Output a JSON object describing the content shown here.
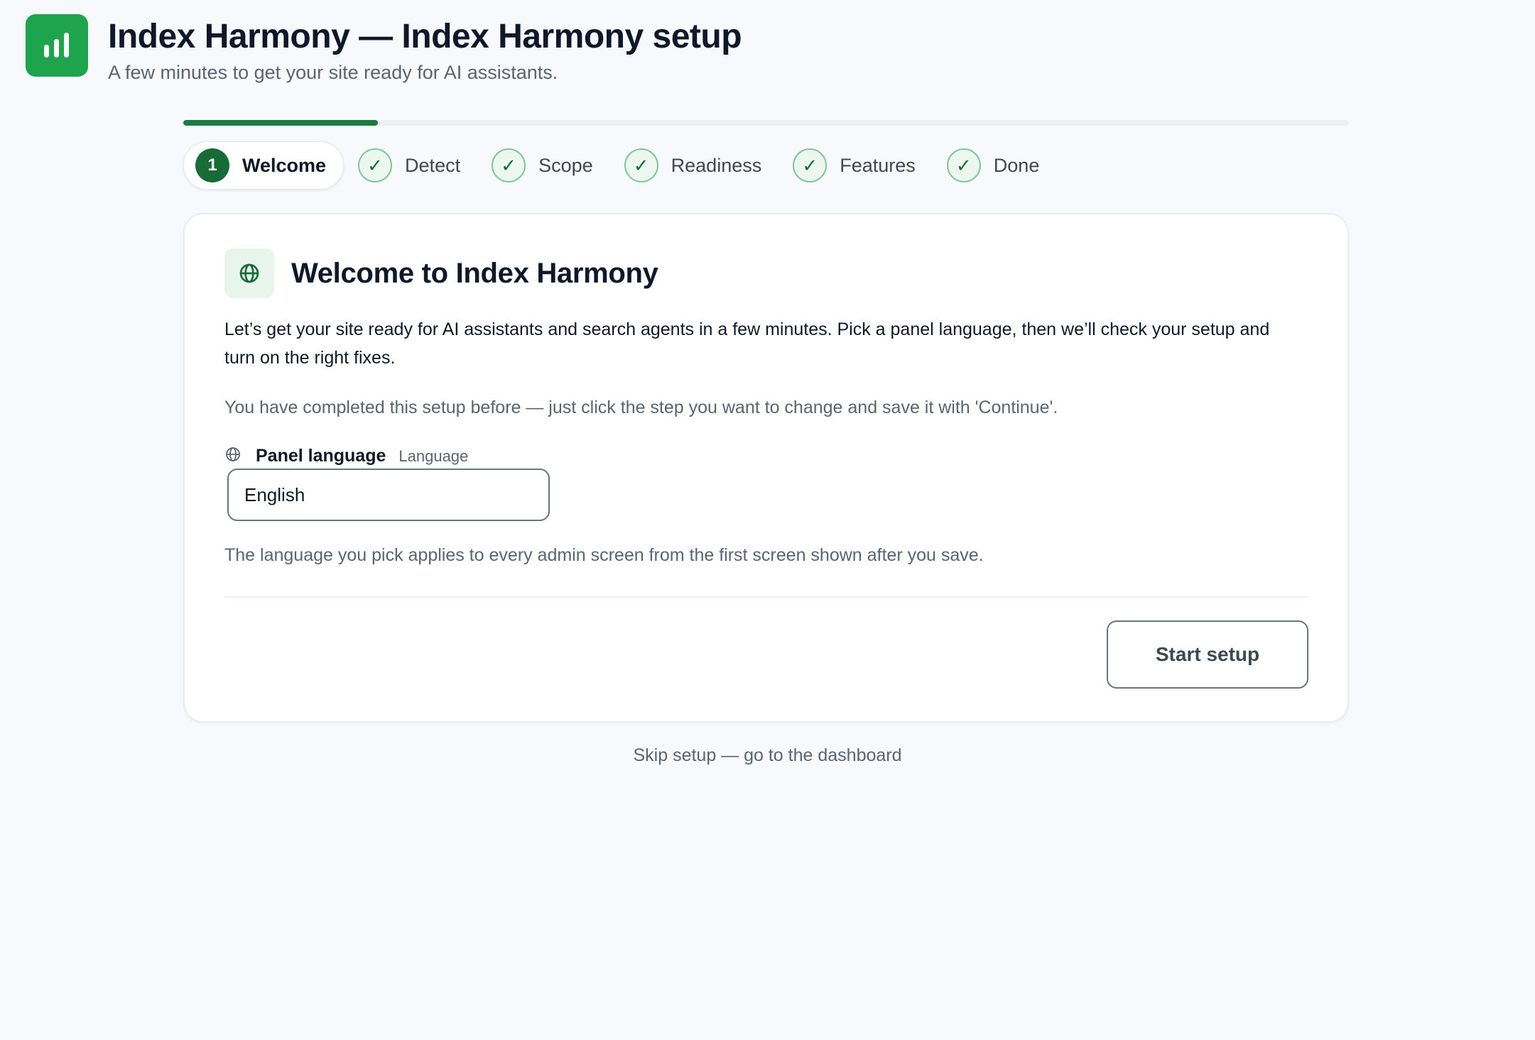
{
  "header": {
    "logo_icon": "bar-chart-icon",
    "title": "Index Harmony — Index Harmony setup",
    "subtitle": "A few minutes to get your site ready for AI assistants."
  },
  "progress": {
    "value": 0.167
  },
  "steps": [
    {
      "label": "Welcome",
      "marker": "1",
      "state": "active"
    },
    {
      "label": "Detect",
      "marker": "✓",
      "state": "done"
    },
    {
      "label": "Scope",
      "marker": "✓",
      "state": "done"
    },
    {
      "label": "Readiness",
      "marker": "✓",
      "state": "done"
    },
    {
      "label": "Features",
      "marker": "✓",
      "state": "done"
    },
    {
      "label": "Done",
      "marker": "✓",
      "state": "done"
    }
  ],
  "card": {
    "icon": "globe-icon",
    "title": "Welcome to Index Harmony",
    "intro": "Let’s get your site ready for AI assistants and search agents in a few minutes. Pick a panel language, then we’ll check your setup and turn on the right fixes.",
    "note": "You have completed this setup before — just click the step you want to change and save it with 'Continue'.",
    "language_field": {
      "icon": "globe-icon",
      "label": "Panel language",
      "sublabel": "Language",
      "value": "English"
    },
    "help": "The language you pick applies to every admin screen from the first screen shown after you save.",
    "start_button": "Start setup"
  },
  "skip_link": "Skip setup — go to the dashboard",
  "colors": {
    "brand": "#1ea44c",
    "accent": "#176b36",
    "background": "#f7f9fc"
  }
}
